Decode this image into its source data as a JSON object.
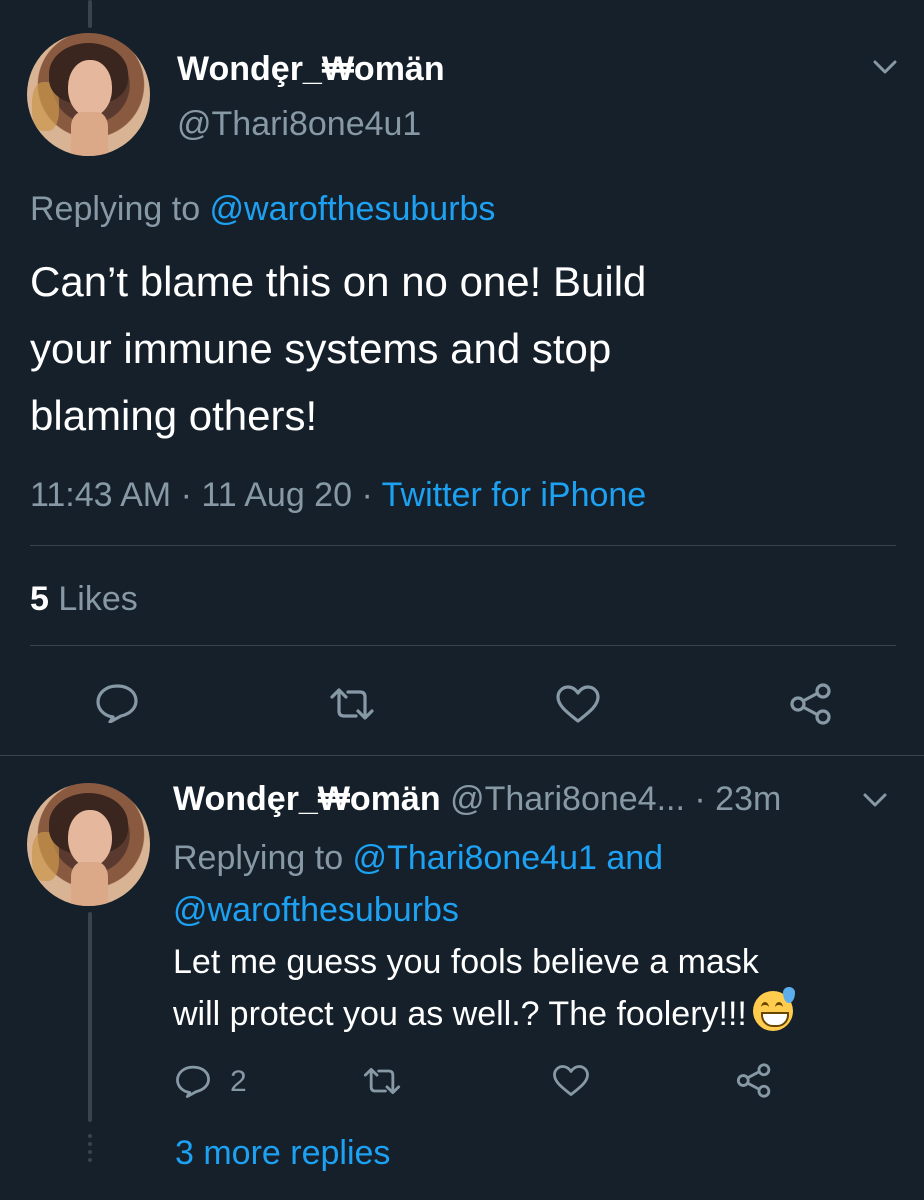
{
  "main_tweet": {
    "display_name": "Wondȩr_₩omän",
    "handle": "@Thari8one4u1",
    "replying_prefix": "Replying to ",
    "replying_to": "@warofthesuburbs",
    "text_lines": [
      "Can’t blame this on no one! Build",
      "your immune systems and stop",
      "blaming others!"
    ],
    "time": "11:43 AM",
    "sep": "·",
    "date": "11 Aug 20",
    "source": "Twitter for iPhone",
    "likes_count": "5",
    "likes_label": "Likes",
    "icons": [
      "reply-icon",
      "retweet-icon",
      "like-icon",
      "share-icon"
    ]
  },
  "reply_tweet": {
    "display_name": "Wondȩr_₩omän",
    "handle": "@Thari8one4...",
    "age": "· 23m",
    "replying_prefix": "Replying to ",
    "replying_to_1": "@Thari8one4u1",
    "replying_and": " and",
    "replying_to_2": "@warofthesuburbs",
    "text_lines": [
      "Let me guess you fools believe a mask",
      "will protect you as well.? The foolery!!!"
    ],
    "emoji": "grinning-face-with-sweat-emoji",
    "reply_count": "2",
    "more_replies": "3 more replies"
  },
  "colors": {
    "background": "#15202b",
    "accent": "#1da1f2",
    "muted": "#8899a6",
    "divider": "#38444d"
  }
}
